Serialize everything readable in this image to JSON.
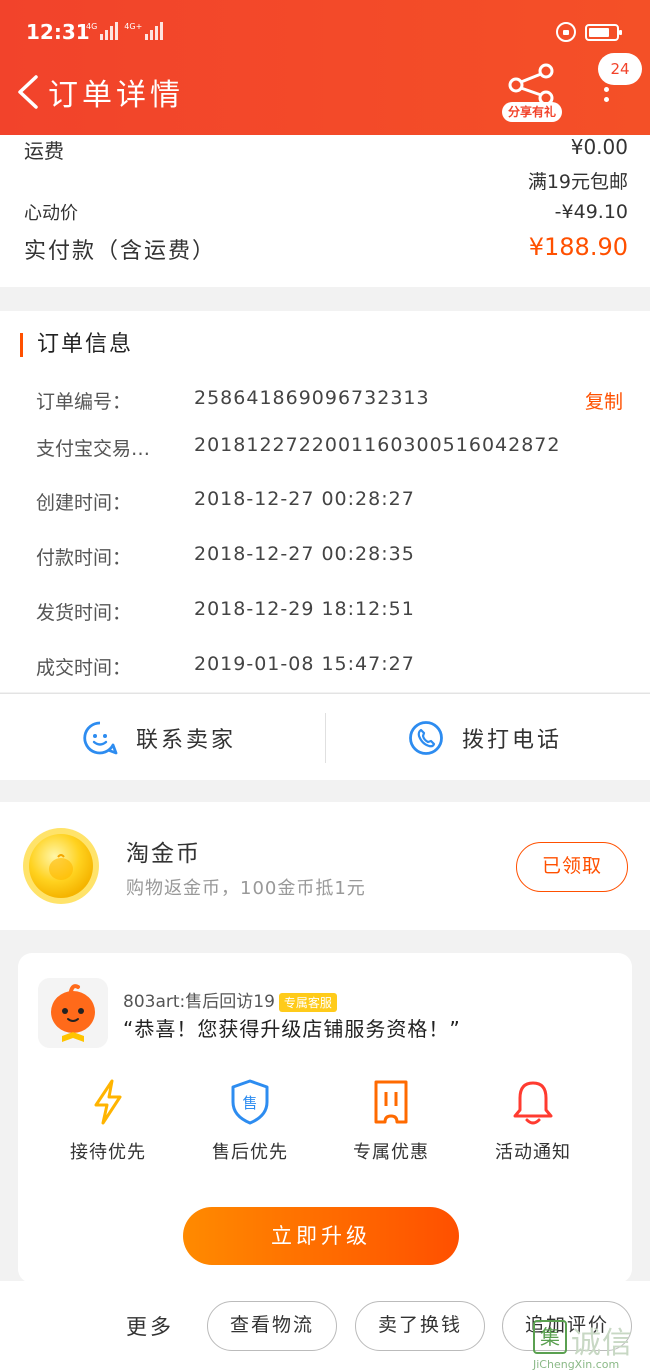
{
  "status_bar": {
    "time": "12:31",
    "signal_1": "4G",
    "signal_2": "4G+"
  },
  "header": {
    "title": "订单详情",
    "share_label": "分享有礼",
    "message_count": "24"
  },
  "price": {
    "shipping_label": "运费",
    "shipping_value": "¥0.00",
    "shipping_note": "满19元包邮",
    "discount_label": "心动价",
    "discount_value": "-¥49.10",
    "total_label": "实付款（含运费）",
    "total_value": "¥188.90"
  },
  "order_info": {
    "title": "订单信息",
    "copy_label": "复制",
    "rows": [
      {
        "label": "订单编号：",
        "value": "258641869096732313"
      },
      {
        "label": "支付宝交易…",
        "value": "2018122722001160300516042872"
      },
      {
        "label": "创建时间：",
        "value": "2018-12-27 00:28:27"
      },
      {
        "label": "付款时间：",
        "value": "2018-12-27 00:28:35"
      },
      {
        "label": "发货时间：",
        "value": "2018-12-29 18:12:51"
      },
      {
        "label": "成交时间：",
        "value": "2019-01-08 15:47:27"
      }
    ]
  },
  "contact": {
    "seller_label": "联系卖家",
    "phone_label": "拨打电话"
  },
  "coin": {
    "title": "淘金币",
    "subtitle": "购物返金币，100金币抵1元",
    "button": "已领取"
  },
  "upgrade": {
    "shop_name": "803art:售后回访19",
    "shop_tag": "专属客服",
    "message": "“恭喜！您获得升级店铺服务资格！”",
    "benefits": [
      {
        "label": "接待优先",
        "icon": "lightning-icon",
        "color": "#ffb400"
      },
      {
        "label": "售后优先",
        "icon": "shield-icon",
        "color": "#2d8cf0"
      },
      {
        "label": "专属优惠",
        "icon": "ticket-icon",
        "color": "#ff6a00"
      },
      {
        "label": "活动通知",
        "icon": "bell-icon",
        "color": "#ff3b30"
      }
    ],
    "button": "立即升级"
  },
  "bottom": {
    "more": "更多",
    "logistics": "查看物流",
    "sell": "卖了换钱",
    "review": "追加评价"
  },
  "watermark": {
    "text": "诚信",
    "logo_char": "集",
    "url": "JiChengXin.com"
  },
  "colors": {
    "brand": "#f2432b",
    "accent": "#ff5000"
  }
}
